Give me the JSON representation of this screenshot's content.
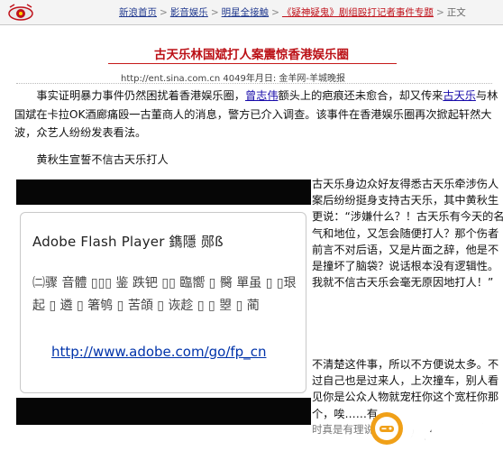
{
  "breadcrumbs": [
    {
      "label": "新浪首页",
      "style": "link"
    },
    {
      "label": "影音娱乐",
      "style": "link"
    },
    {
      "label": "明星全接触",
      "style": "link"
    },
    {
      "label": "《疑神疑鬼》剧组殴打记者事件专题",
      "style": "red"
    },
    {
      "label": "正文",
      "style": "plain"
    }
  ],
  "breadcrumb_sep": ">",
  "article": {
    "title": "古天乐林国斌打人案震惊香港娱乐圈",
    "meta": "http://ent.sina.com.cn 4049年月日: 金羊网-羊城晚报",
    "para1_before": "事实证明暴力事件仍然困扰着香港娱乐圈，",
    "para1_link1": "曾志伟",
    "para1_mid": "额头上的疤痕还未愈合，却又传来",
    "para1_link2": "古天乐",
    "para1_after": "与林国斌在卡拉OK酒廊痛殴一古董商人的消息，警方已介入调查。该事件在香港娱乐圈再次掀起轩然大波，众艺人纷纷发表看法。",
    "para2": "黄秋生宣誓不信古天乐打人"
  },
  "flash": {
    "title": "Adobe Flash Player 鐫隱 郧ß",
    "mojibake": "㈡骤 音體 ▯▯▯ 鉴 跌钯 ▯▯ 臨嚮 ▯ 臋 單虽 ▯ ▯珢起 ▯ 遴 ▯ 箸鸲 ▯ 苦頜 ▯ 诙趁 ▯ ▯ 曌 ▯ 蔺",
    "url": "http://www.adobe.com/go/fp_cn"
  },
  "side_text": "古天乐身边众好友得悉古天乐牵涉伤人案后纷纷挺身支持古天乐，其中黄秋生更说：“涉嫌什么？！古天乐有今天的名气和地位，又怎会随便打人？那个伤者前言不对后语，又是片面之辞，他是不是撞坏了脑袋？说话根本没有逻辑性。我就不信古天乐会毫无原因地打人！”",
  "side_text_2": "不清楚这件事，所以不方便说太多。不过自己也是过来人，上次撞车，别人看见你是公众人物就宠枉你这个宽枉你那个，唉……有",
  "footer_fragment": "时真是有理说不清",
  "watermark": {
    "text": "元码手游网"
  },
  "colors": {
    "title_red": "#bb1016",
    "link_blue": "#1a0dab",
    "crumb_red": "#c0111a"
  }
}
